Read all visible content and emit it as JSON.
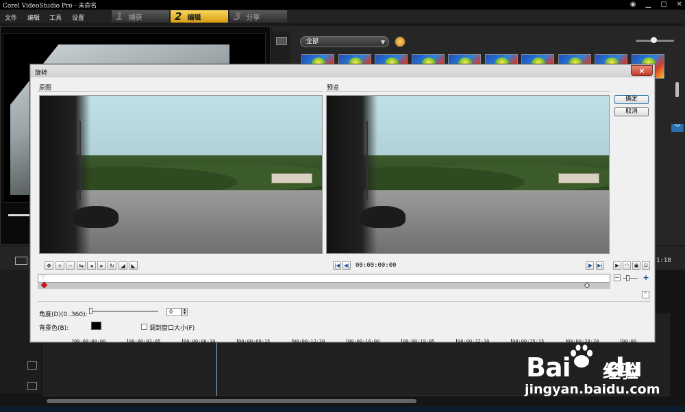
{
  "app": {
    "title": "Corel VideoStudio Pro - 未命名",
    "menu": [
      "文件",
      "编辑",
      "工具",
      "设置"
    ],
    "steps": [
      {
        "num": "1",
        "label": "捕获"
      },
      {
        "num": "2",
        "label": "编辑"
      },
      {
        "num": "3",
        "label": "分享"
      }
    ],
    "active_step": 1
  },
  "library": {
    "dropdown_value": "全部",
    "thumb_count": 10
  },
  "timeline": {
    "time": "1:18"
  },
  "dialog": {
    "title": "旋转",
    "close": "×",
    "original_label": "原图",
    "preview_label": "预览",
    "ok": "确定",
    "cancel": "取消",
    "preview_time": "00:00:00:00",
    "ruler_labels": [
      "00:00:00:00",
      "00:00:03:05",
      "00:00:06:10",
      "00:00:09:15",
      "00:00:12:20",
      "00:00:16:00",
      "00:00:19:05",
      "00:00:22:10",
      "00:00:25:15",
      "00:00:28:20",
      "00:00"
    ],
    "angle_label": "角度(D)(0..360):",
    "angle_value": "0",
    "bgcolor_label": "背景色(B):",
    "bgcolor": "#000000",
    "fit_label": "调到窗口大小(F)"
  },
  "watermark": {
    "bai": "Bai",
    "du": "du",
    "jingyan": "经验",
    "url": "jingyan.baidu.com"
  }
}
